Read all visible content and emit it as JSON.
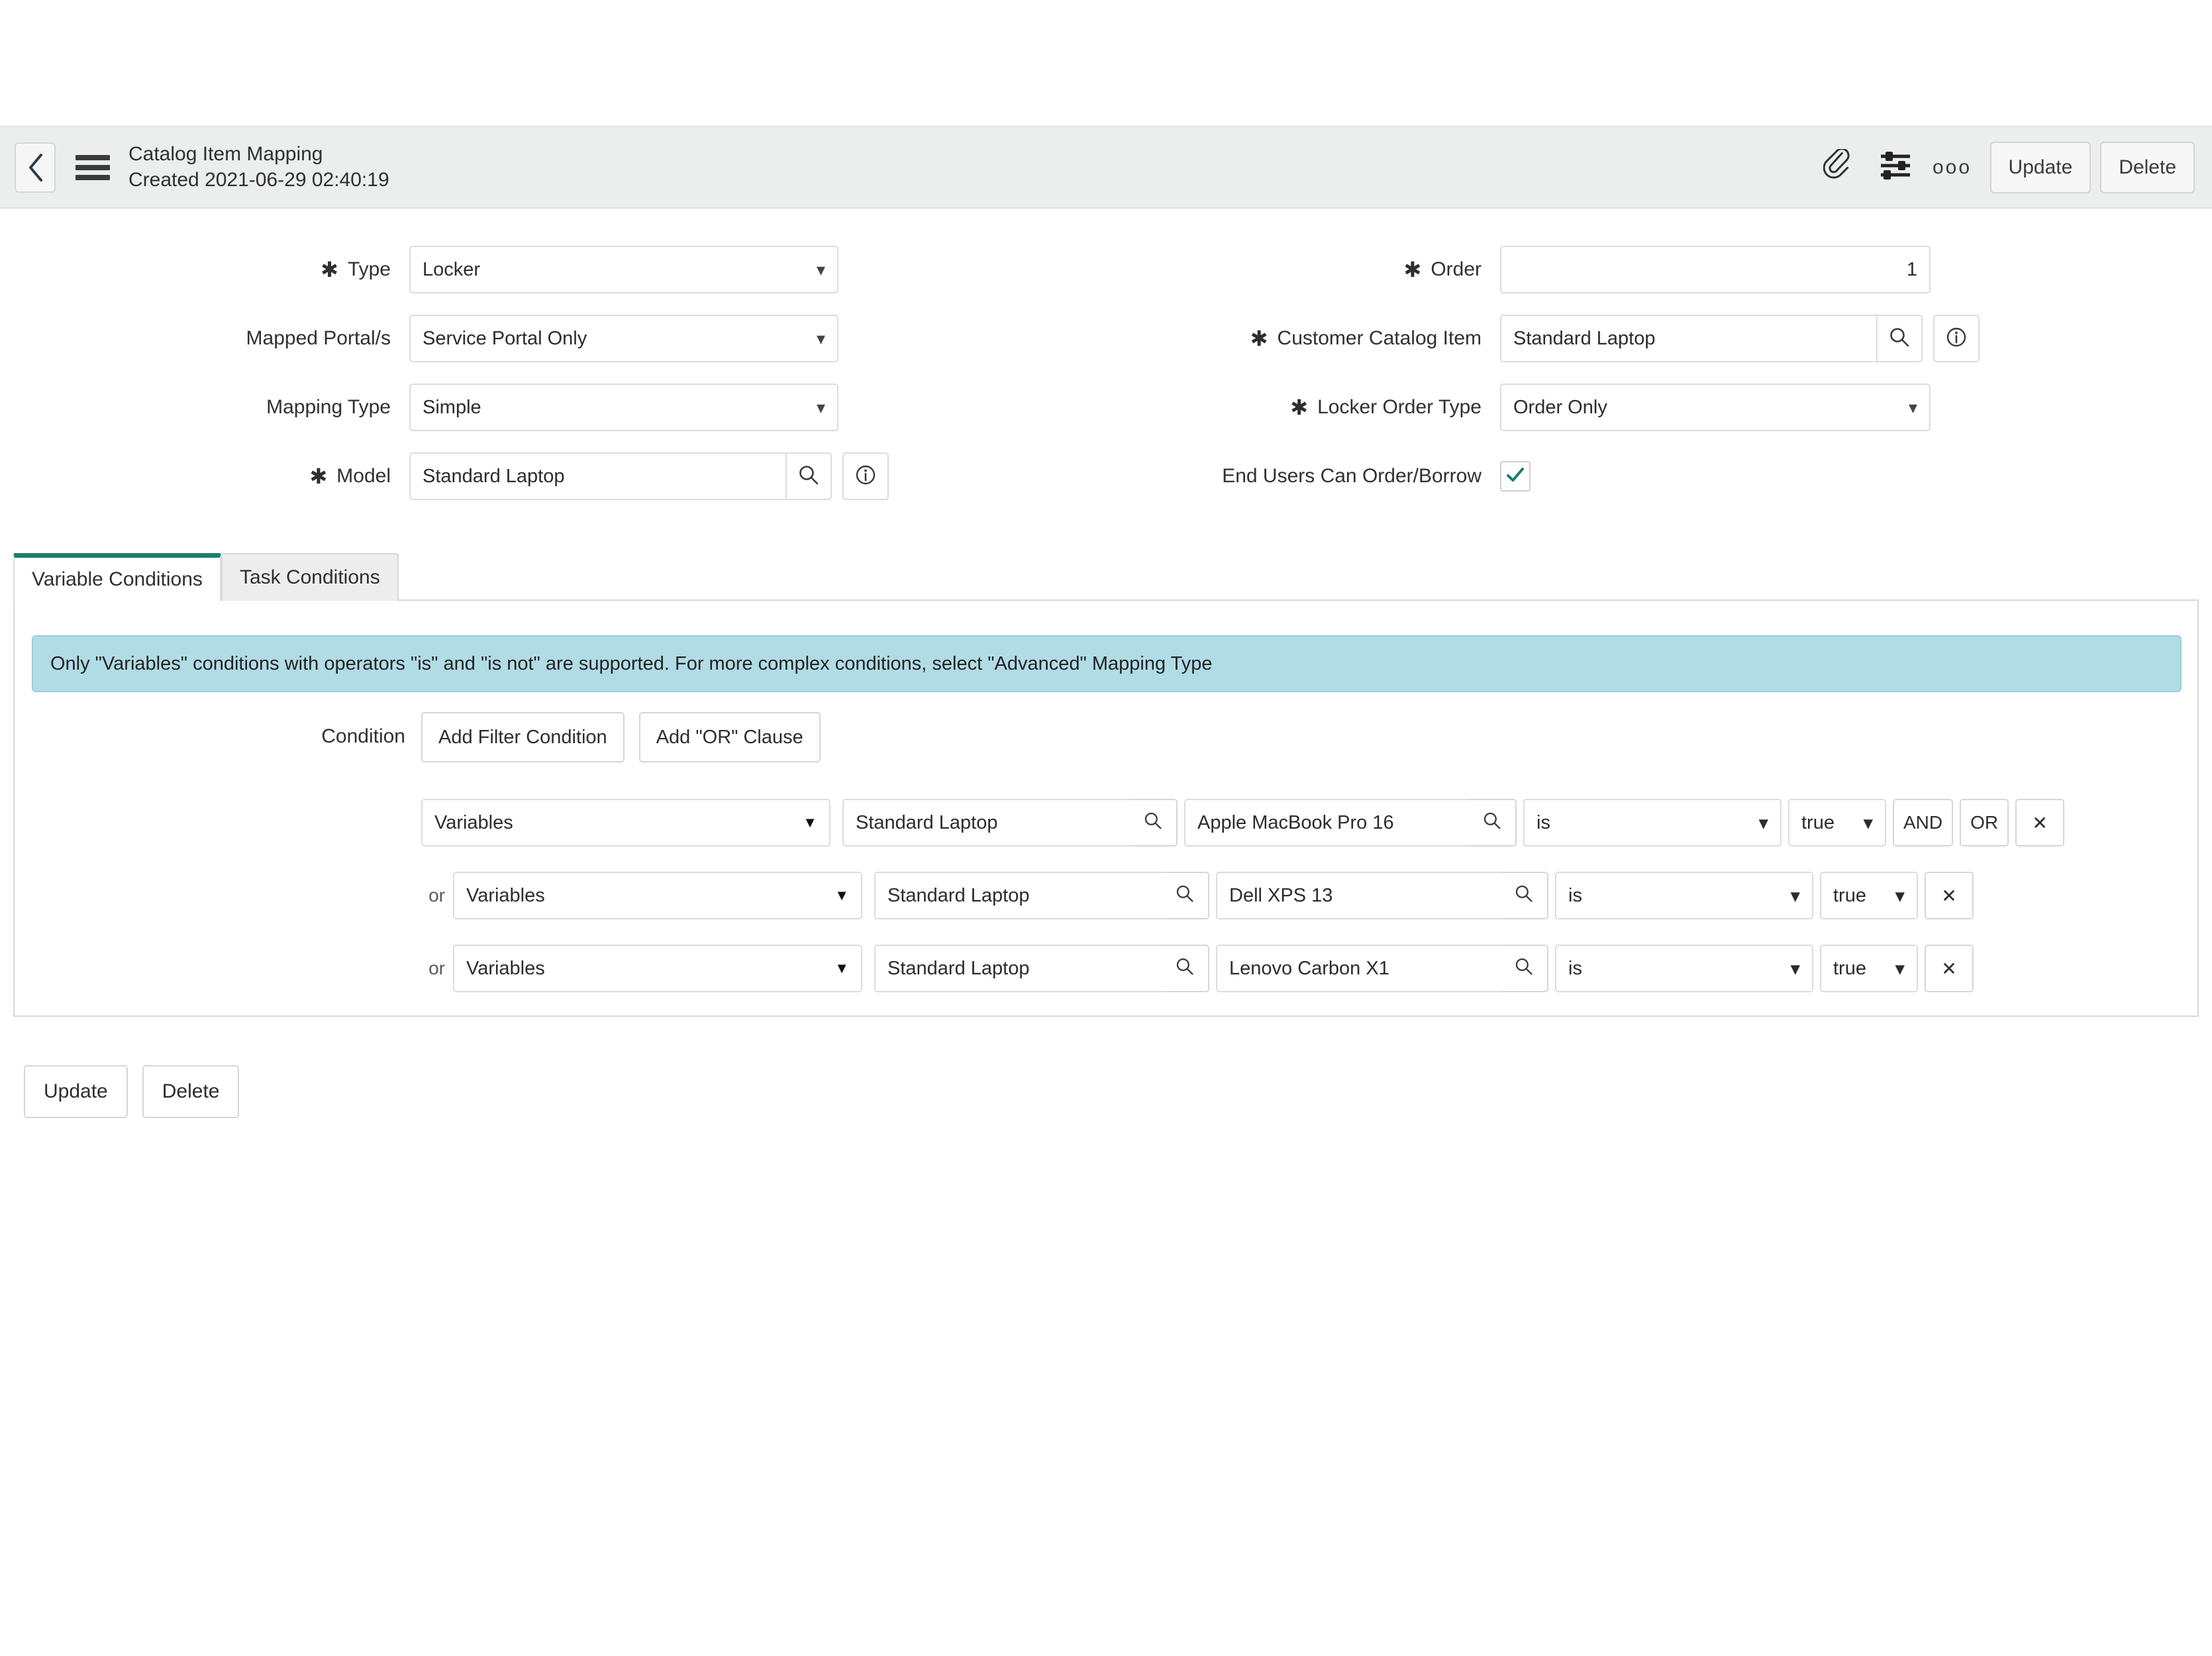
{
  "header": {
    "title": "Catalog Item Mapping",
    "subtitle": "Created 2021-06-29 02:40:19",
    "back_icon": "chevron-left-icon",
    "menu_icon": "hamburger-icon",
    "attachment_icon": "paperclip-icon",
    "personalize_icon": "sliders-icon",
    "more_icon": "ooo",
    "update_label": "Update",
    "delete_label": "Delete"
  },
  "form": {
    "left": [
      {
        "label": "Type",
        "required": true,
        "kind": "select",
        "value": "Locker"
      },
      {
        "label": "Mapped Portal/s",
        "required": false,
        "kind": "select",
        "value": "Service Portal Only"
      },
      {
        "label": "Mapping Type",
        "required": false,
        "kind": "select",
        "value": "Simple"
      },
      {
        "label": "Model",
        "required": true,
        "kind": "reference",
        "value": "Standard Laptop"
      }
    ],
    "right": [
      {
        "label": "Order",
        "required": true,
        "kind": "number",
        "value": "1"
      },
      {
        "label": "Customer Catalog Item",
        "required": true,
        "kind": "reference",
        "value": "Standard Laptop"
      },
      {
        "label": "Locker Order Type",
        "required": true,
        "kind": "select",
        "value": "Order Only"
      },
      {
        "label": "End Users Can Order/Borrow",
        "required": false,
        "kind": "checkbox",
        "checked": true
      }
    ]
  },
  "tabs": [
    {
      "label": "Variable Conditions",
      "active": true
    },
    {
      "label": "Task Conditions",
      "active": false
    }
  ],
  "conditions_panel": {
    "banner_text": "Only \"Variables\" conditions with operators \"is\" and \"is not\" are supported. For more complex conditions, select \"Advanced\" Mapping Type",
    "condition_label": "Condition",
    "add_filter_label": "Add Filter Condition",
    "add_or_label": "Add \"OR\" Clause",
    "or_prefix": "or",
    "and_label": "AND",
    "or_label": "OR",
    "remove_label": "✕",
    "rows": [
      {
        "prefix": "",
        "field_group": "Variables",
        "variable": "Standard Laptop",
        "value": "Apple MacBook Pro 16",
        "operator": "is",
        "boolean_value": "true",
        "has_and_or": true
      },
      {
        "prefix": "or",
        "field_group": "Variables",
        "variable": "Standard Laptop",
        "value": "Dell XPS 13",
        "operator": "is",
        "boolean_value": "true",
        "has_and_or": false
      },
      {
        "prefix": "or",
        "field_group": "Variables",
        "variable": "Standard Laptop",
        "value": "Lenovo Carbon X1",
        "operator": "is",
        "boolean_value": "true",
        "has_and_or": false
      }
    ]
  },
  "footer": {
    "update_label": "Update",
    "delete_label": "Delete"
  },
  "colors": {
    "active_tab_accent": "#17806a",
    "banner_bg": "#b1dce6",
    "header_bg": "#eceded",
    "checkbox_check": "#1a7f6b"
  }
}
